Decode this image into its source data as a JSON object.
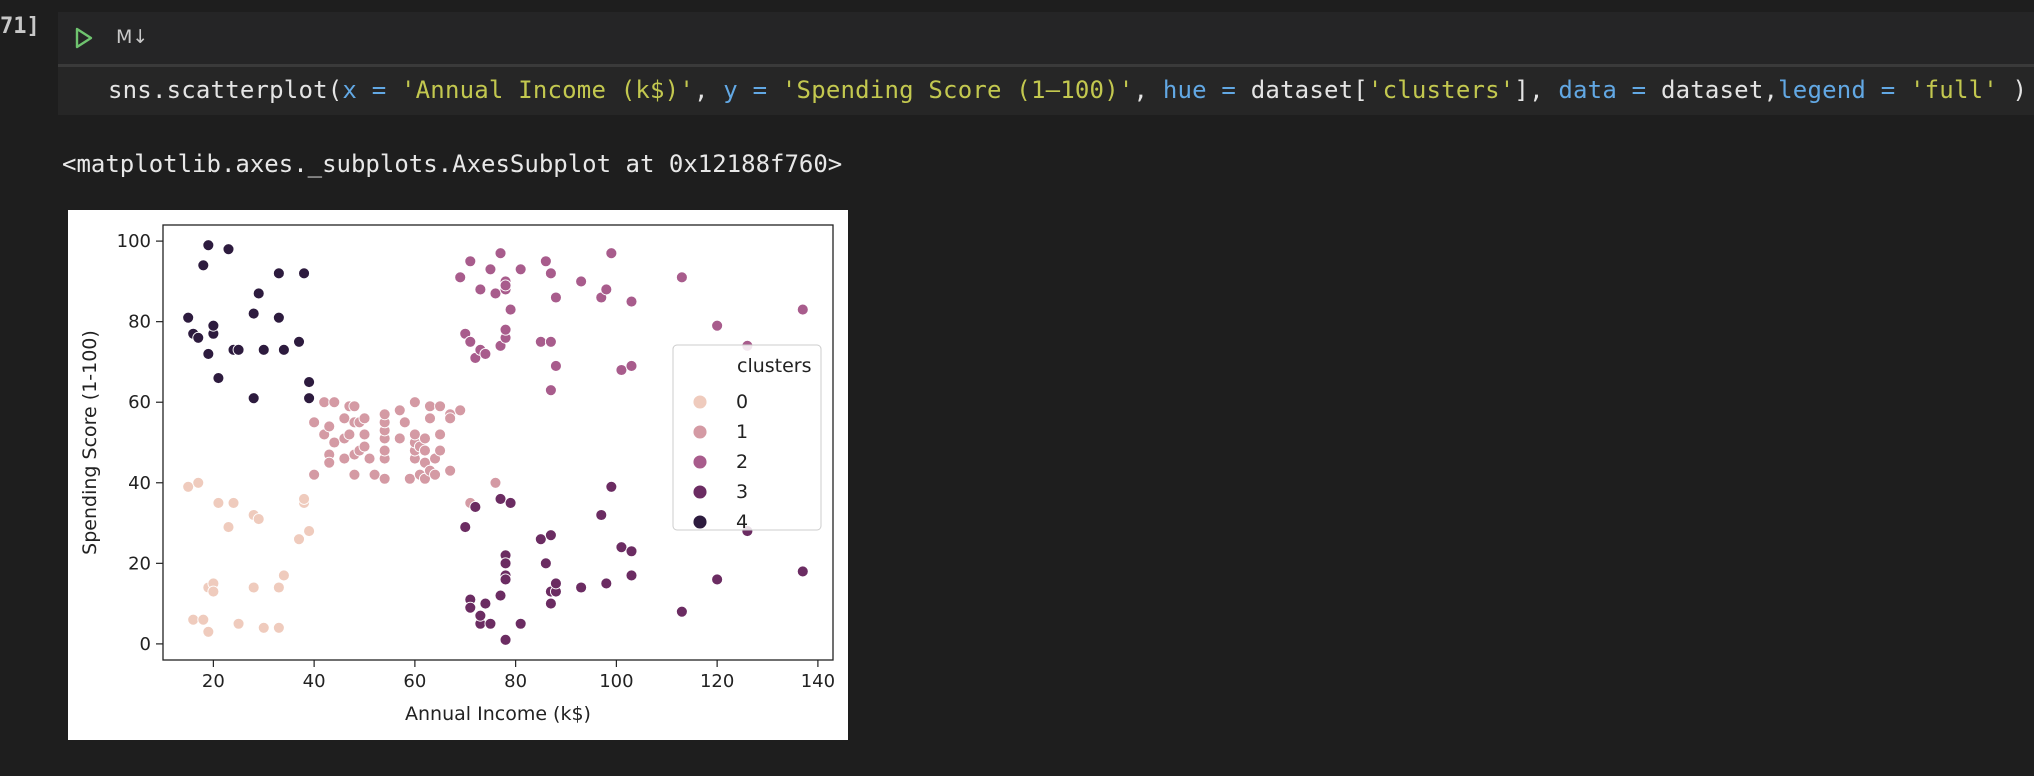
{
  "cell": {
    "execution_count": "71]",
    "run_icon": "play-icon",
    "markdown_toggle": "M↓",
    "code_tokens": [
      {
        "t": "sns.scatterplot(",
        "c": "tk-id"
      },
      {
        "t": "x",
        "c": "tk-kw"
      },
      {
        "t": " = ",
        "c": "tk-kw"
      },
      {
        "t": "'Annual Income (k$)'",
        "c": "tk-str"
      },
      {
        "t": ", ",
        "c": "tk-op"
      },
      {
        "t": "y",
        "c": "tk-kw"
      },
      {
        "t": " = ",
        "c": "tk-kw"
      },
      {
        "t": "'Spending Score (1–100)'",
        "c": "tk-str"
      },
      {
        "t": ", ",
        "c": "tk-op"
      },
      {
        "t": "hue",
        "c": "tk-kw"
      },
      {
        "t": " = ",
        "c": "tk-kw"
      },
      {
        "t": "dataset[",
        "c": "tk-id"
      },
      {
        "t": "'clusters'",
        "c": "tk-str"
      },
      {
        "t": "], ",
        "c": "tk-id"
      },
      {
        "t": "data",
        "c": "tk-kw"
      },
      {
        "t": " = ",
        "c": "tk-kw"
      },
      {
        "t": "dataset,",
        "c": "tk-id"
      },
      {
        "t": "legend",
        "c": "tk-kw"
      },
      {
        "t": " = ",
        "c": "tk-kw"
      },
      {
        "t": "'full'",
        "c": "tk-str"
      },
      {
        "t": " )",
        "c": "tk-op"
      }
    ],
    "output_repr": "<matplotlib.axes._subplots.AxesSubplot at 0x12188f760>"
  },
  "colors": {
    "background": "#1e1e1e",
    "cluster_0": "#efcbbd",
    "cluster_1": "#d49aa4",
    "cluster_2": "#a85c8c",
    "cluster_3": "#6b2c62",
    "cluster_4": "#2d1b3e"
  },
  "chart_data": {
    "type": "scatter",
    "xlabel": "Annual Income (k$)",
    "ylabel": "Spending Score (1-100)",
    "xlim": [
      10,
      143
    ],
    "ylim": [
      -4,
      104
    ],
    "xticks": [
      20,
      40,
      60,
      80,
      100,
      120,
      140
    ],
    "yticks": [
      0,
      20,
      40,
      60,
      80,
      100
    ],
    "legend": {
      "title": "clusters",
      "position": "center-right",
      "entries": [
        "0",
        "1",
        "2",
        "3",
        "4"
      ]
    },
    "series": [
      {
        "name": "0",
        "color": "#efcbbd",
        "points": [
          [
            15,
            39
          ],
          [
            16,
            6
          ],
          [
            17,
            40
          ],
          [
            18,
            6
          ],
          [
            19,
            3
          ],
          [
            19,
            14
          ],
          [
            20,
            15
          ],
          [
            20,
            13
          ],
          [
            21,
            35
          ],
          [
            23,
            29
          ],
          [
            24,
            35
          ],
          [
            25,
            5
          ],
          [
            28,
            14
          ],
          [
            28,
            32
          ],
          [
            29,
            31
          ],
          [
            30,
            4
          ],
          [
            33,
            4
          ],
          [
            33,
            14
          ],
          [
            34,
            17
          ],
          [
            37,
            26
          ],
          [
            38,
            35
          ],
          [
            39,
            28
          ],
          [
            38,
            36
          ]
        ]
      },
      {
        "name": "1",
        "color": "#d49aa4",
        "points": [
          [
            40,
            42
          ],
          [
            40,
            55
          ],
          [
            42,
            52
          ],
          [
            42,
            60
          ],
          [
            43,
            54
          ],
          [
            43,
            47
          ],
          [
            43,
            45
          ],
          [
            44,
            50
          ],
          [
            44,
            60
          ],
          [
            46,
            46
          ],
          [
            46,
            56
          ],
          [
            46,
            51
          ],
          [
            47,
            52
          ],
          [
            47,
            59
          ],
          [
            48,
            47
          ],
          [
            48,
            55
          ],
          [
            48,
            42
          ],
          [
            48,
            59
          ],
          [
            49,
            48
          ],
          [
            49,
            55
          ],
          [
            50,
            49
          ],
          [
            50,
            52
          ],
          [
            50,
            56
          ],
          [
            51,
            46
          ],
          [
            52,
            42
          ],
          [
            54,
            41
          ],
          [
            54,
            46
          ],
          [
            54,
            48
          ],
          [
            54,
            51
          ],
          [
            54,
            53
          ],
          [
            54,
            55
          ],
          [
            54,
            57
          ],
          [
            57,
            51
          ],
          [
            57,
            58
          ],
          [
            58,
            55
          ],
          [
            59,
            41
          ],
          [
            60,
            46
          ],
          [
            60,
            48
          ],
          [
            60,
            50
          ],
          [
            60,
            52
          ],
          [
            60,
            60
          ],
          [
            61,
            42
          ],
          [
            61,
            49
          ],
          [
            62,
            41
          ],
          [
            62,
            45
          ],
          [
            62,
            48
          ],
          [
            62,
            51
          ],
          [
            63,
            43
          ],
          [
            63,
            56
          ],
          [
            63,
            59
          ],
          [
            64,
            42
          ],
          [
            64,
            46
          ],
          [
            65,
            48
          ],
          [
            65,
            52
          ],
          [
            65,
            59
          ],
          [
            67,
            43
          ],
          [
            67,
            57
          ],
          [
            67,
            56
          ],
          [
            69,
            58
          ],
          [
            71,
            35
          ],
          [
            76,
            40
          ]
        ]
      },
      {
        "name": "2",
        "color": "#a85c8c",
        "points": [
          [
            69,
            91
          ],
          [
            70,
            77
          ],
          [
            71,
            95
          ],
          [
            71,
            75
          ],
          [
            71,
            75
          ],
          [
            72,
            71
          ],
          [
            73,
            88
          ],
          [
            73,
            73
          ],
          [
            74,
            72
          ],
          [
            75,
            93
          ],
          [
            76,
            87
          ],
          [
            77,
            97
          ],
          [
            77,
            74
          ],
          [
            78,
            90
          ],
          [
            78,
            88
          ],
          [
            78,
            76
          ],
          [
            78,
            89
          ],
          [
            78,
            78
          ],
          [
            79,
            83
          ],
          [
            81,
            93
          ],
          [
            85,
            75
          ],
          [
            86,
            95
          ],
          [
            87,
            63
          ],
          [
            87,
            92
          ],
          [
            87,
            75
          ],
          [
            88,
            86
          ],
          [
            88,
            69
          ],
          [
            93,
            90
          ],
          [
            97,
            86
          ],
          [
            98,
            88
          ],
          [
            99,
            97
          ],
          [
            101,
            68
          ],
          [
            103,
            85
          ],
          [
            103,
            69
          ],
          [
            113,
            91
          ],
          [
            120,
            79
          ],
          [
            126,
            74
          ],
          [
            137,
            83
          ]
        ]
      },
      {
        "name": "3",
        "color": "#6b2c62",
        "points": [
          [
            70,
            29
          ],
          [
            71,
            11
          ],
          [
            71,
            9
          ],
          [
            72,
            34
          ],
          [
            73,
            5
          ],
          [
            73,
            7
          ],
          [
            74,
            10
          ],
          [
            75,
            5
          ],
          [
            77,
            12
          ],
          [
            77,
            36
          ],
          [
            78,
            22
          ],
          [
            78,
            17
          ],
          [
            78,
            20
          ],
          [
            78,
            16
          ],
          [
            78,
            1
          ],
          [
            78,
            1
          ],
          [
            79,
            35
          ],
          [
            81,
            5
          ],
          [
            85,
            26
          ],
          [
            86,
            20
          ],
          [
            87,
            27
          ],
          [
            87,
            13
          ],
          [
            87,
            10
          ],
          [
            88,
            13
          ],
          [
            88,
            15
          ],
          [
            93,
            14
          ],
          [
            97,
            32
          ],
          [
            98,
            15
          ],
          [
            99,
            39
          ],
          [
            101,
            24
          ],
          [
            103,
            17
          ],
          [
            103,
            23
          ],
          [
            113,
            8
          ],
          [
            120,
            16
          ],
          [
            126,
            28
          ],
          [
            137,
            18
          ]
        ]
      },
      {
        "name": "4",
        "color": "#2d1b3e",
        "points": [
          [
            15,
            81
          ],
          [
            16,
            77
          ],
          [
            17,
            76
          ],
          [
            18,
            94
          ],
          [
            19,
            72
          ],
          [
            19,
            99
          ],
          [
            20,
            77
          ],
          [
            20,
            79
          ],
          [
            21,
            66
          ],
          [
            23,
            98
          ],
          [
            24,
            73
          ],
          [
            25,
            73
          ],
          [
            28,
            82
          ],
          [
            28,
            61
          ],
          [
            29,
            87
          ],
          [
            30,
            73
          ],
          [
            33,
            81
          ],
          [
            33,
            92
          ],
          [
            34,
            73
          ],
          [
            37,
            75
          ],
          [
            38,
            92
          ],
          [
            39,
            65
          ],
          [
            39,
            61
          ]
        ]
      }
    ]
  }
}
